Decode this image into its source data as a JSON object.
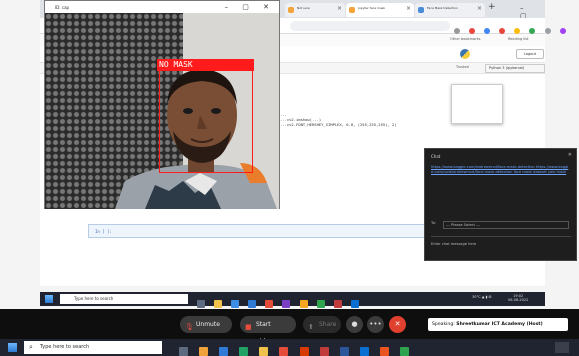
{
  "remote_browser": {
    "tabs": [
      {
        "label": "Not sure",
        "active": false
      },
      {
        "label": "Jupyter face mask",
        "active": true
      },
      {
        "label": "Face Mask Detection",
        "active": false
      }
    ],
    "new_tab": "+",
    "window_controls": "– ▢ ✕",
    "bookmarks": {
      "other": "Other bookmarks",
      "reading": "Reading list"
    }
  },
  "jupyter": {
    "logout": "Logout",
    "trusted": "Trusted",
    "kernel": "Python 3 (ipykernel)",
    "code_lines": [
      "...",
      "...cv2.imshow(...)",
      "...cv2.FONT_HERSHEY_SIMPLEX, 0.8, (255,255,255), 2)"
    ],
    "cell_prompt": "In [ ]:"
  },
  "camera_window": {
    "title": "ID: cap",
    "controls": "– ▢ ✕",
    "detection_label": "NO MASK",
    "detection_color": "#ff1b1b"
  },
  "chat": {
    "title": "Chat",
    "close": "✕",
    "message": "https://www.kaggle.com/andrewmvd/face-mask-detection https://www.kaggle.com/code/andrewmvd/face-mask-detection face mask dataset yolo mask",
    "to_label": "To:",
    "to_placeholder": "--- Please Select ---",
    "input_placeholder": "Enter chat message here"
  },
  "remote_taskbar": {
    "search_placeholder": "Type here to search",
    "tray": "30°C  ▲  ▮  ⊞",
    "time": "19:02",
    "date": "06-06-2022"
  },
  "meeting": {
    "unmute": "Unmute",
    "start_video": "Start video",
    "share": "Share",
    "more": "•••",
    "hangup": "✕",
    "speaking_prefix": "Speaking:",
    "speaking_name": "Shreetkumar ICT Academy (Host)"
  },
  "local_taskbar": {
    "search_placeholder": "Type here to search"
  }
}
